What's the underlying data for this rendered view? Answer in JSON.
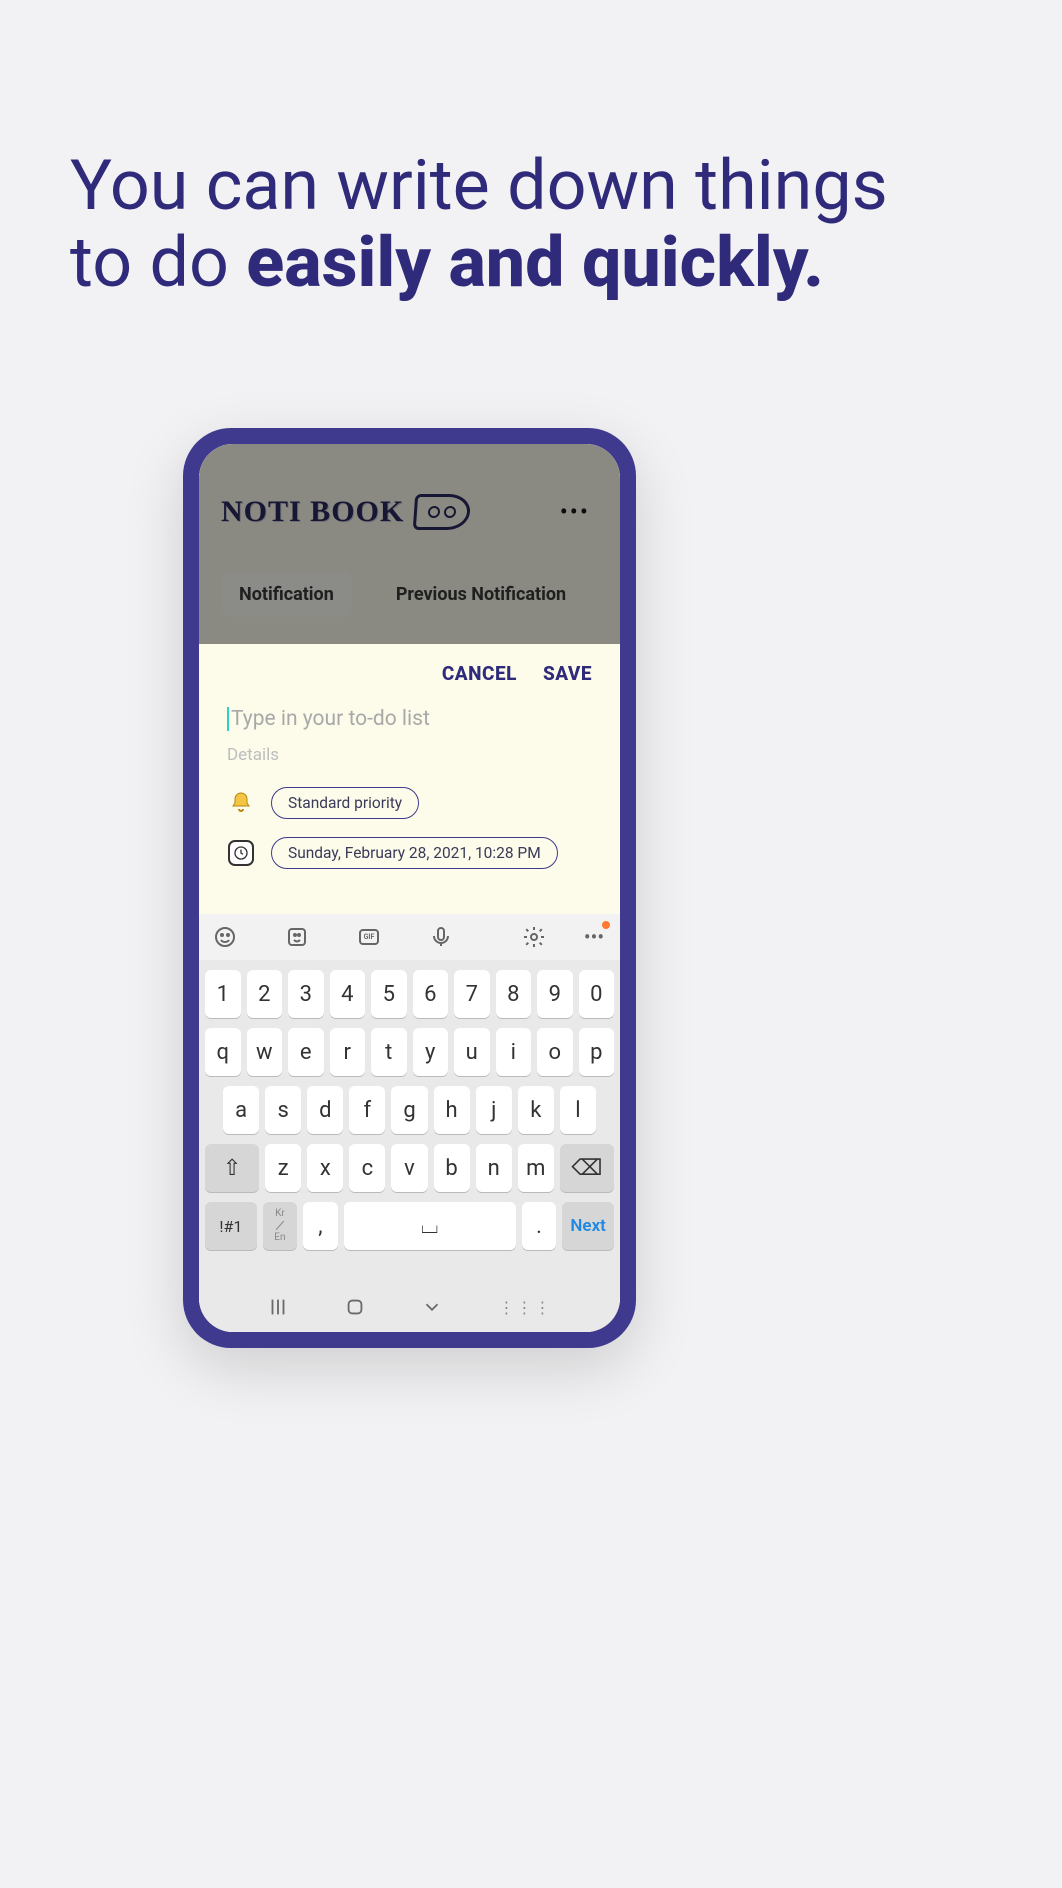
{
  "headline": {
    "line1": "You can write down things",
    "line2_plain": "to do ",
    "line2_bold": "easily and quickly."
  },
  "app": {
    "title": "NOTI BOOK",
    "menu_icon": "more-icon",
    "tabs": {
      "active": "Notification",
      "inactive": "Previous Notification"
    }
  },
  "sheet": {
    "cancel": "CANCEL",
    "save": "SAVE",
    "todo_placeholder": "Type in your to-do list",
    "details_placeholder": "Details",
    "priority_chip": "Standard priority",
    "datetime_chip": "Sunday, February 28, 2021, 10:28 PM"
  },
  "keyboard": {
    "row_num": [
      "1",
      "2",
      "3",
      "4",
      "5",
      "6",
      "7",
      "8",
      "9",
      "0"
    ],
    "row_q": [
      "q",
      "w",
      "e",
      "r",
      "t",
      "y",
      "u",
      "i",
      "o",
      "p"
    ],
    "row_a": [
      "a",
      "s",
      "d",
      "f",
      "g",
      "h",
      "j",
      "k",
      "l"
    ],
    "row_z": [
      "z",
      "x",
      "c",
      "v",
      "b",
      "n",
      "m"
    ],
    "shift": "⇧",
    "backspace": "⌫",
    "symbols": "!#1",
    "lang_top": "Kr",
    "lang_bot": "En",
    "comma": ",",
    "space": "⌴",
    "period": ".",
    "next": "Next"
  }
}
